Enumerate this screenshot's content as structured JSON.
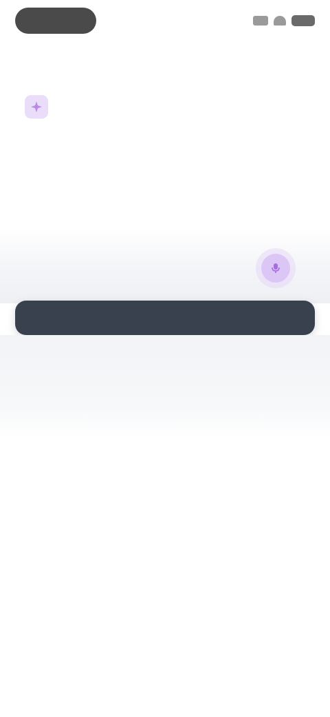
{
  "status_bar": {
    "time": "",
    "signal_icon": "signal-icon",
    "wifi_icon": "wifi-icon",
    "battery_icon": "battery-icon"
  },
  "header": {
    "small_action": ""
  },
  "top": {
    "brand_icon": "spark-icon",
    "link_label": "",
    "title": "",
    "lines": [
      "",
      "",
      ""
    ]
  },
  "middle": {
    "subhead": "",
    "mic_icon": "microphone-icon"
  },
  "action_bar": {
    "items": [
      "",
      "",
      ""
    ]
  },
  "lower": {
    "row1": "",
    "row2": ""
  },
  "colors": {
    "accent_purple": "#b98ae8",
    "dark_bar": "#38414d",
    "background": "#ffffff"
  }
}
